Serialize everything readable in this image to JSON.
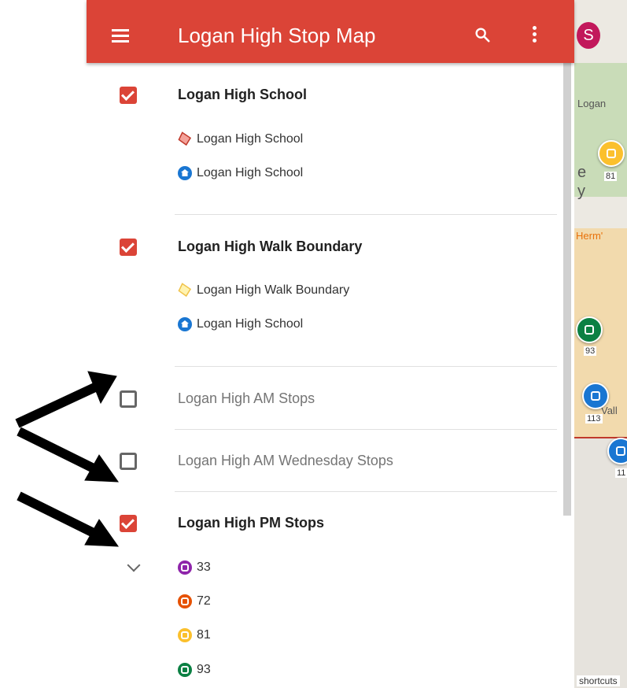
{
  "header": {
    "title": "Logan High Stop Map",
    "color": "#db4437"
  },
  "map": {
    "labels": [
      "Logan",
      "e",
      "y",
      "81",
      "Herm'",
      "93",
      "113",
      "Vall",
      "11"
    ],
    "avatar": "S",
    "shortcuts": "shortcuts"
  },
  "layers": [
    {
      "title": "Logan High School",
      "checked": true,
      "items": [
        {
          "icon": "polygon-icon",
          "label": "Logan High School"
        },
        {
          "icon": "school-pin-icon",
          "label": "Logan High School"
        }
      ]
    },
    {
      "title": "Logan High Walk Boundary",
      "checked": true,
      "items": [
        {
          "icon": "polygon-icon",
          "label": "Logan High Walk Boundary"
        },
        {
          "icon": "school-pin-icon",
          "label": "Logan High School"
        }
      ]
    },
    {
      "title": "Logan High AM Stops",
      "checked": false,
      "items": []
    },
    {
      "title": "Logan High AM Wednesday Stops",
      "checked": false,
      "items": []
    },
    {
      "title": "Logan High PM Stops",
      "checked": true,
      "items": [
        {
          "icon": "bus-icon",
          "label": "33",
          "color": "#8e24aa"
        },
        {
          "icon": "bus-icon",
          "label": "72",
          "color": "#e65100"
        },
        {
          "icon": "bus-icon",
          "label": "81",
          "color": "#fbc02d"
        },
        {
          "icon": "bus-icon",
          "label": "93",
          "color": "#0b8043"
        }
      ]
    }
  ]
}
